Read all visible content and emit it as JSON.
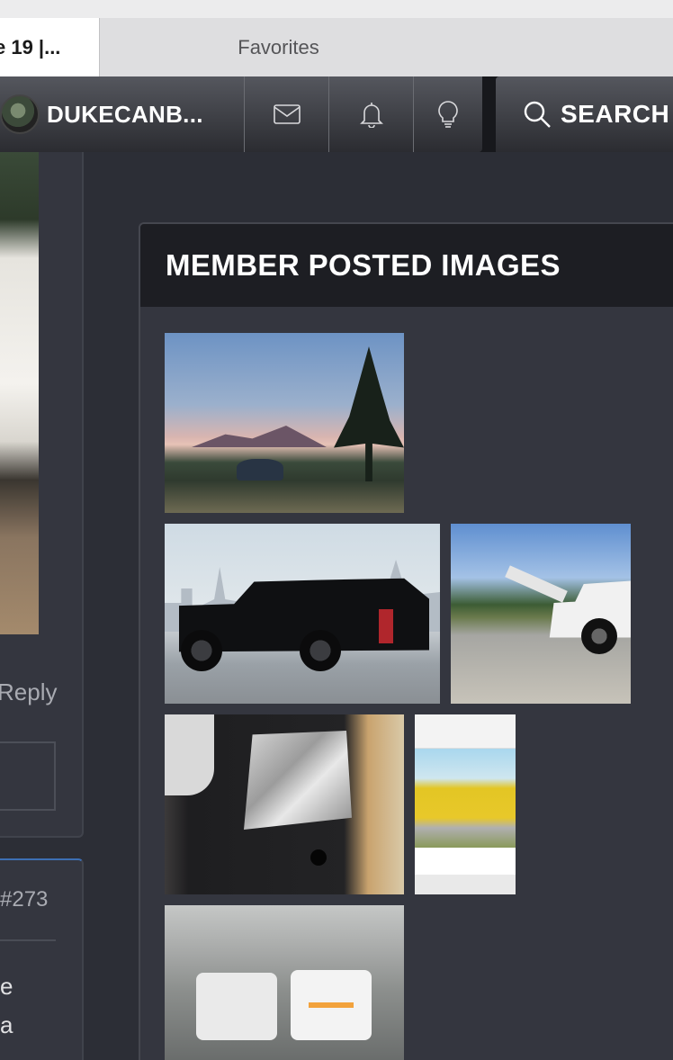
{
  "browser": {
    "active_tab_title": "e 19 |...",
    "favorites_tab_title": "Favorites"
  },
  "nav": {
    "username": "DUKECANB...",
    "icons": [
      "mail-icon",
      "bell-icon",
      "lightbulb-icon",
      "search-icon"
    ],
    "search_label": "SEARCH"
  },
  "left_column": {
    "reply_label": "Reply",
    "post_number": "#273",
    "post_text_line1": "e",
    "post_text_line2": "a"
  },
  "widget": {
    "title": "MEMBER POSTED IMAGES",
    "images": [
      "campsite-at-dusk",
      "black-truck-city-skyline",
      "white-truck-driveway",
      "foil-on-panel",
      "instagram-yellow-truck",
      "trucks-in-parking-garage"
    ]
  },
  "colors": {
    "page_background": "#2c2e36",
    "header_bar": "#1d1e23",
    "accent_blue": "#3d6fb4"
  }
}
